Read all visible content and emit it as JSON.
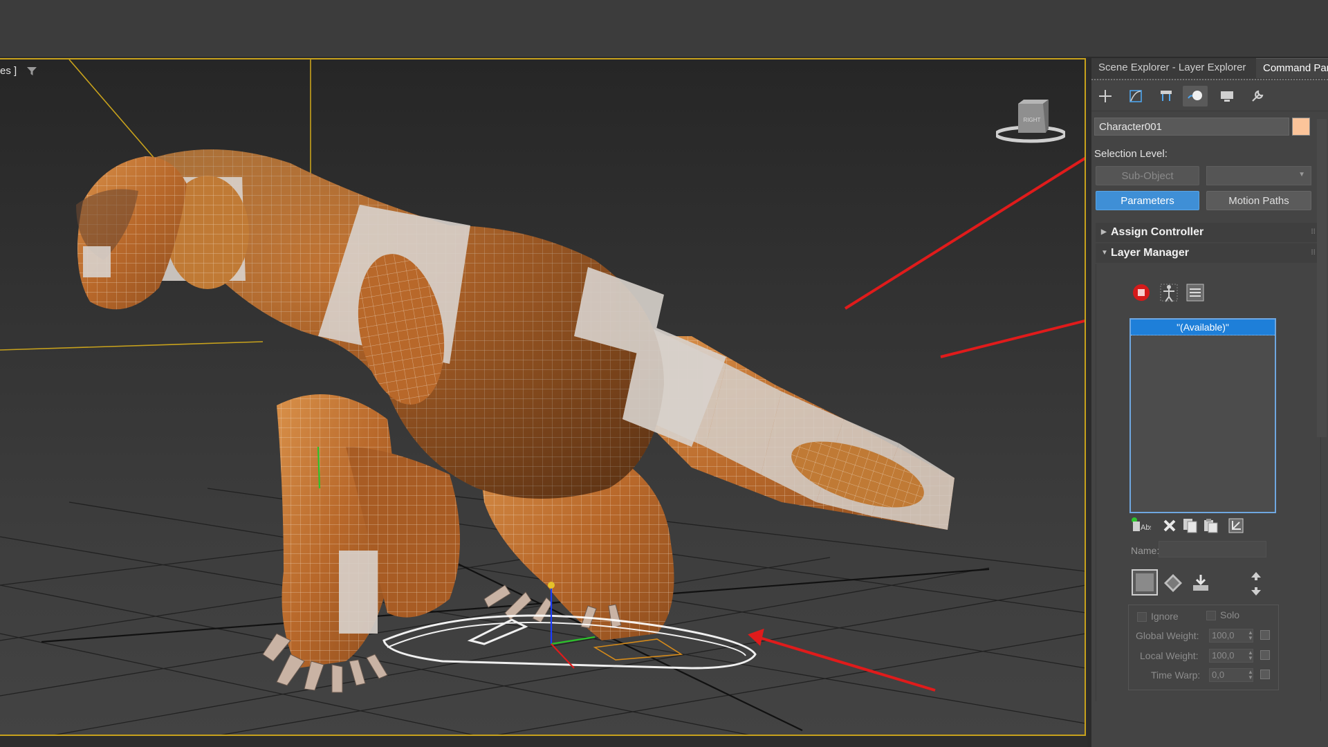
{
  "viewport": {
    "label": "es ]",
    "viewcube_face": "RIGHT"
  },
  "panel": {
    "tabs": [
      {
        "label": "Scene Explorer - Layer Explorer"
      },
      {
        "label": "Command Panel"
      }
    ],
    "toolbar_icons": [
      "create-icon",
      "modify-icon",
      "hierarchy-icon",
      "motion-icon",
      "display-icon",
      "utilities-icon"
    ],
    "object_name": "Character001",
    "object_color": "#fbc49a",
    "selection_level_label": "Selection Level:",
    "sub_object_label": "Sub-Object",
    "parameters_label": "Parameters",
    "motion_paths_label": "Motion Paths",
    "assign_controller_label": "Assign Controller",
    "layer_manager_label": "Layer Manager",
    "layers": [
      {
        "label": "\"(Available)\""
      }
    ],
    "abs_label": "Abs",
    "name_label": "Name:",
    "ignore_label": "Ignore",
    "solo_label": "Solo",
    "global_weight_label": "Global Weight:",
    "global_weight_value": "100,0",
    "local_weight_label": "Local Weight:",
    "local_weight_value": "100,0",
    "time_warp_label": "Time Warp:",
    "time_warp_value": "0,0"
  },
  "colors": {
    "viewport_border": "#c8a21c",
    "selection_blue": "#3f8fd6",
    "annotation_arrow": "#e01b1b",
    "model_fur": "#c07a35"
  }
}
